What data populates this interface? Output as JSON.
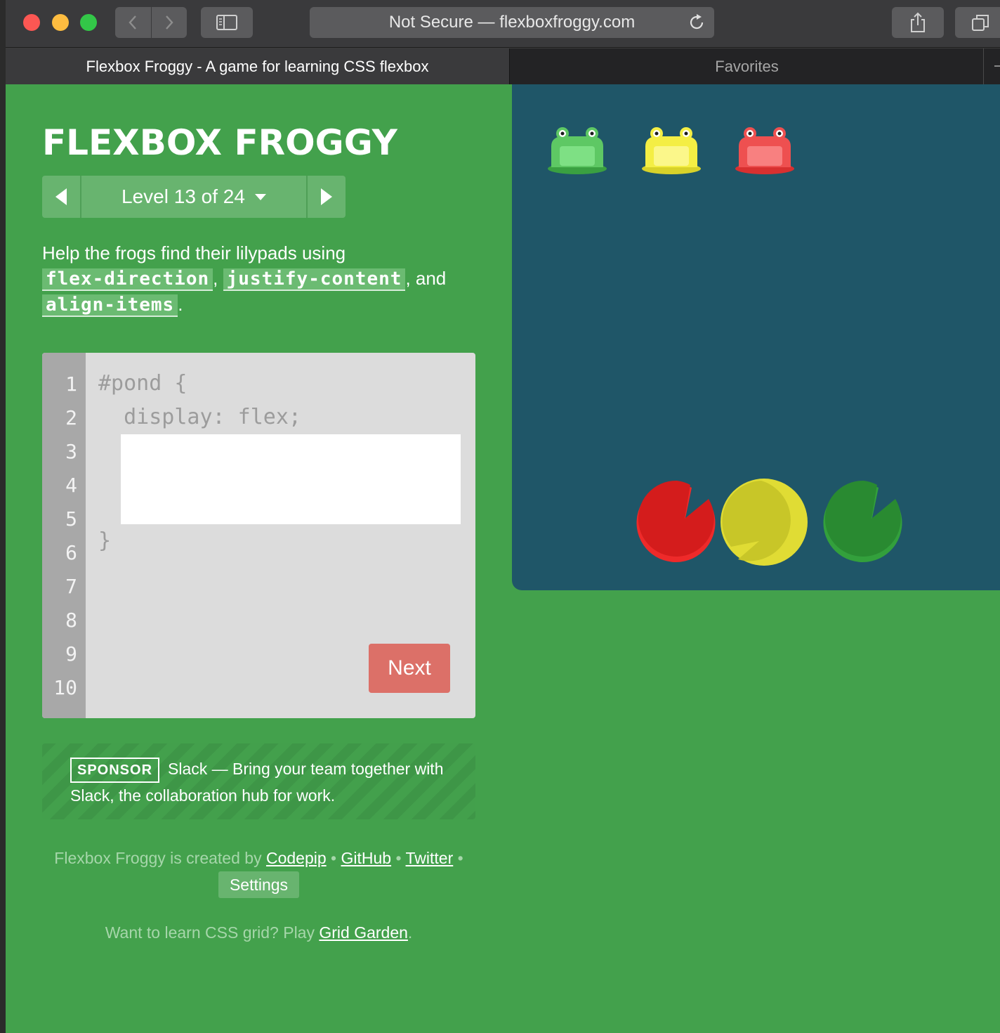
{
  "browser": {
    "address": "Not Secure — flexboxfroggy.com",
    "active_tab": "Flexbox Froggy - A game for learning CSS flexbox",
    "favorites_tab": "Favorites"
  },
  "game": {
    "title": "FLEXBOX FROGGY",
    "level_label": "Level 13 of 24",
    "instructions": {
      "prefix": "Help the frogs find their lilypads using",
      "kw1": "flex-direction",
      "sep1": ",",
      "kw2": "justify-content",
      "sep2": ", and",
      "kw3": "align-items",
      "end": "."
    },
    "editor": {
      "line_numbers": [
        "1",
        "2",
        "3",
        "4",
        "5",
        "6",
        "7",
        "8",
        "9",
        "10"
      ],
      "line1": "#pond {",
      "line2": "  display: flex;",
      "line_close": "}",
      "input_value": "",
      "next_label": "Next"
    },
    "sponsor": {
      "badge": "SPONSOR",
      "text": "Slack — Bring your team together with Slack, the collaboration hub for work."
    },
    "footer": {
      "created_by": "Flexbox Froggy is created by",
      "codepip": "Codepip",
      "github": "GitHub",
      "twitter": "Twitter",
      "bullet": "•",
      "settings": "Settings"
    },
    "grid_promo": {
      "text": "Want to learn CSS grid? Play",
      "link": "Grid Garden",
      "end": "."
    },
    "pond": {
      "frogs": [
        "green",
        "yellow",
        "red"
      ],
      "lilypads": [
        "red",
        "yellow",
        "green"
      ]
    },
    "colors": {
      "background": "#43a14c",
      "pond": "#1f5668",
      "next_button": "#dc7068",
      "frog_green": "#5ec864",
      "frog_yellow": "#f4ee44",
      "frog_red": "#ee5050",
      "pad_red": "#d41c1c",
      "pad_yellow": "#c8c628",
      "pad_green": "#298a31"
    }
  }
}
